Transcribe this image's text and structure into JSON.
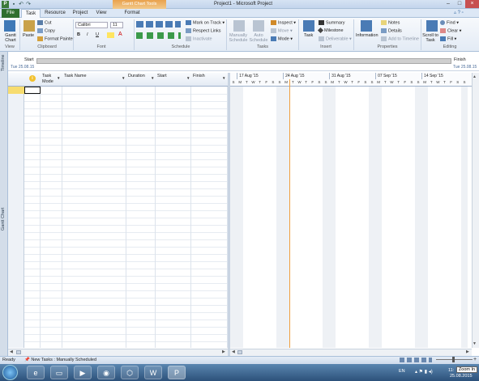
{
  "title_bar": {
    "app_icon": "P",
    "context_tab": "Gantt Chart Tools",
    "window_title": "Project1 - Microsoft Project",
    "icons": {
      "save": "save-icon",
      "undo": "undo-icon",
      "redo": "redo-icon"
    }
  },
  "tabs": {
    "file": "File",
    "task": "Task",
    "resource": "Resource",
    "project": "Project",
    "view": "View",
    "format": "Format"
  },
  "ribbon": {
    "view": {
      "gantt_chart": "Gantt Chart",
      "label": "View"
    },
    "clipboard": {
      "paste": "Paste",
      "cut": "Cut",
      "copy": "Copy",
      "format_painter": "Format Painter",
      "label": "Clipboard"
    },
    "font": {
      "family": "Calibri",
      "size": "11",
      "bold": "B",
      "italic": "I",
      "underline": "U",
      "label": "Font"
    },
    "schedule": {
      "mark_on_track": "Mark on Track",
      "respect_links": "Respect Links",
      "inactivate": "Inactivate",
      "label": "Schedule"
    },
    "tasks": {
      "manually_schedule": "Manually Schedule",
      "auto_schedule": "Auto Schedule",
      "inspect": "Inspect",
      "move": "Move",
      "mode": "Mode",
      "label": "Tasks"
    },
    "insert": {
      "task": "Task",
      "summary": "Summary",
      "milestone": "Milestone",
      "deliverable": "Deliverable",
      "label": "Insert"
    },
    "properties": {
      "information": "Information",
      "notes": "Notes",
      "details": "Details",
      "add_to_timeline": "Add to Timeline",
      "label": "Properties"
    },
    "editing": {
      "scroll_to_task": "Scroll to Task",
      "find": "Find",
      "clear": "Clear",
      "fill": "Fill",
      "label": "Editing"
    }
  },
  "timeline": {
    "side_label": "Timeline",
    "start_label": "Start",
    "start_date": "Tue 25.08.15",
    "finish_label": "Finish",
    "finish_date": "Tue 25.08.15"
  },
  "grid": {
    "columns": [
      "Task Mode",
      "Task Name",
      "Duration",
      "Start",
      "Finish"
    ],
    "side_label": "Gantt Chart"
  },
  "gantt": {
    "weeks": [
      "17 Aug '15",
      "24 Aug '15",
      "31 Aug '15",
      "07 Sep '15",
      "14 Sep '15"
    ],
    "days": [
      "S",
      "M",
      "T",
      "W",
      "T",
      "F",
      "S",
      "S",
      "M",
      "T",
      "W",
      "T",
      "F",
      "S",
      "S",
      "M",
      "T",
      "W",
      "T",
      "F",
      "S",
      "S",
      "M",
      "T",
      "W",
      "T",
      "F",
      "S",
      "S",
      "M",
      "T",
      "W",
      "T",
      "F",
      "S",
      "S"
    ]
  },
  "status": {
    "ready": "Ready",
    "new_tasks": "New Tasks : Manually Scheduled"
  },
  "taskbar": {
    "lang": "EN",
    "time": "11:",
    "date": "25.08.2015",
    "zoom_tooltip": "Zoom In"
  },
  "colors": {
    "file_tab": "#2f6f2f",
    "context_tab": "#e9a24d",
    "today_line": "#f0a040",
    "selected_row": "#f7dc6f"
  }
}
